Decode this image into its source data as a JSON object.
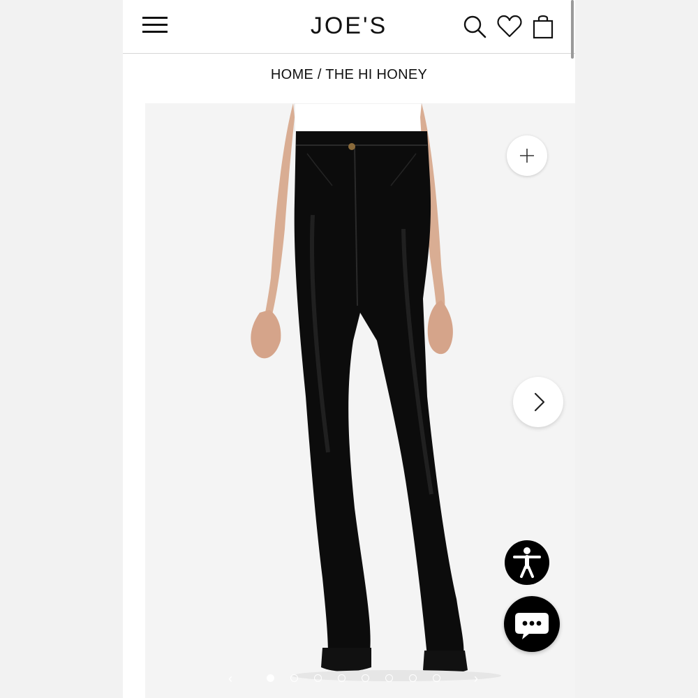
{
  "header": {
    "brand": "JOE'S",
    "icons": {
      "menu": "hamburger-menu-icon",
      "search": "search-icon",
      "wishlist": "heart-icon",
      "cart": "shopping-bag-icon"
    }
  },
  "breadcrumb": {
    "home": "HOME",
    "separator": "/",
    "current": "THE HI HONEY"
  },
  "gallery": {
    "image_subject": "product-photo-black-coated-flare-jeans",
    "slide_count": 8,
    "active_slide": 1,
    "controls": {
      "zoom": "plus-icon",
      "next": "chevron-right-icon",
      "prev_small": "chevron-left-icon",
      "next_small": "chevron-right-icon"
    }
  },
  "floating": {
    "accessibility": "accessibility-person-icon",
    "chat": "chat-bubble-icon"
  },
  "colors": {
    "text": "#111111",
    "background": "#ffffff",
    "gallery_bg": "#f4f4f4",
    "jeans": "#0c0c0c",
    "floating_bg": "#000000"
  }
}
